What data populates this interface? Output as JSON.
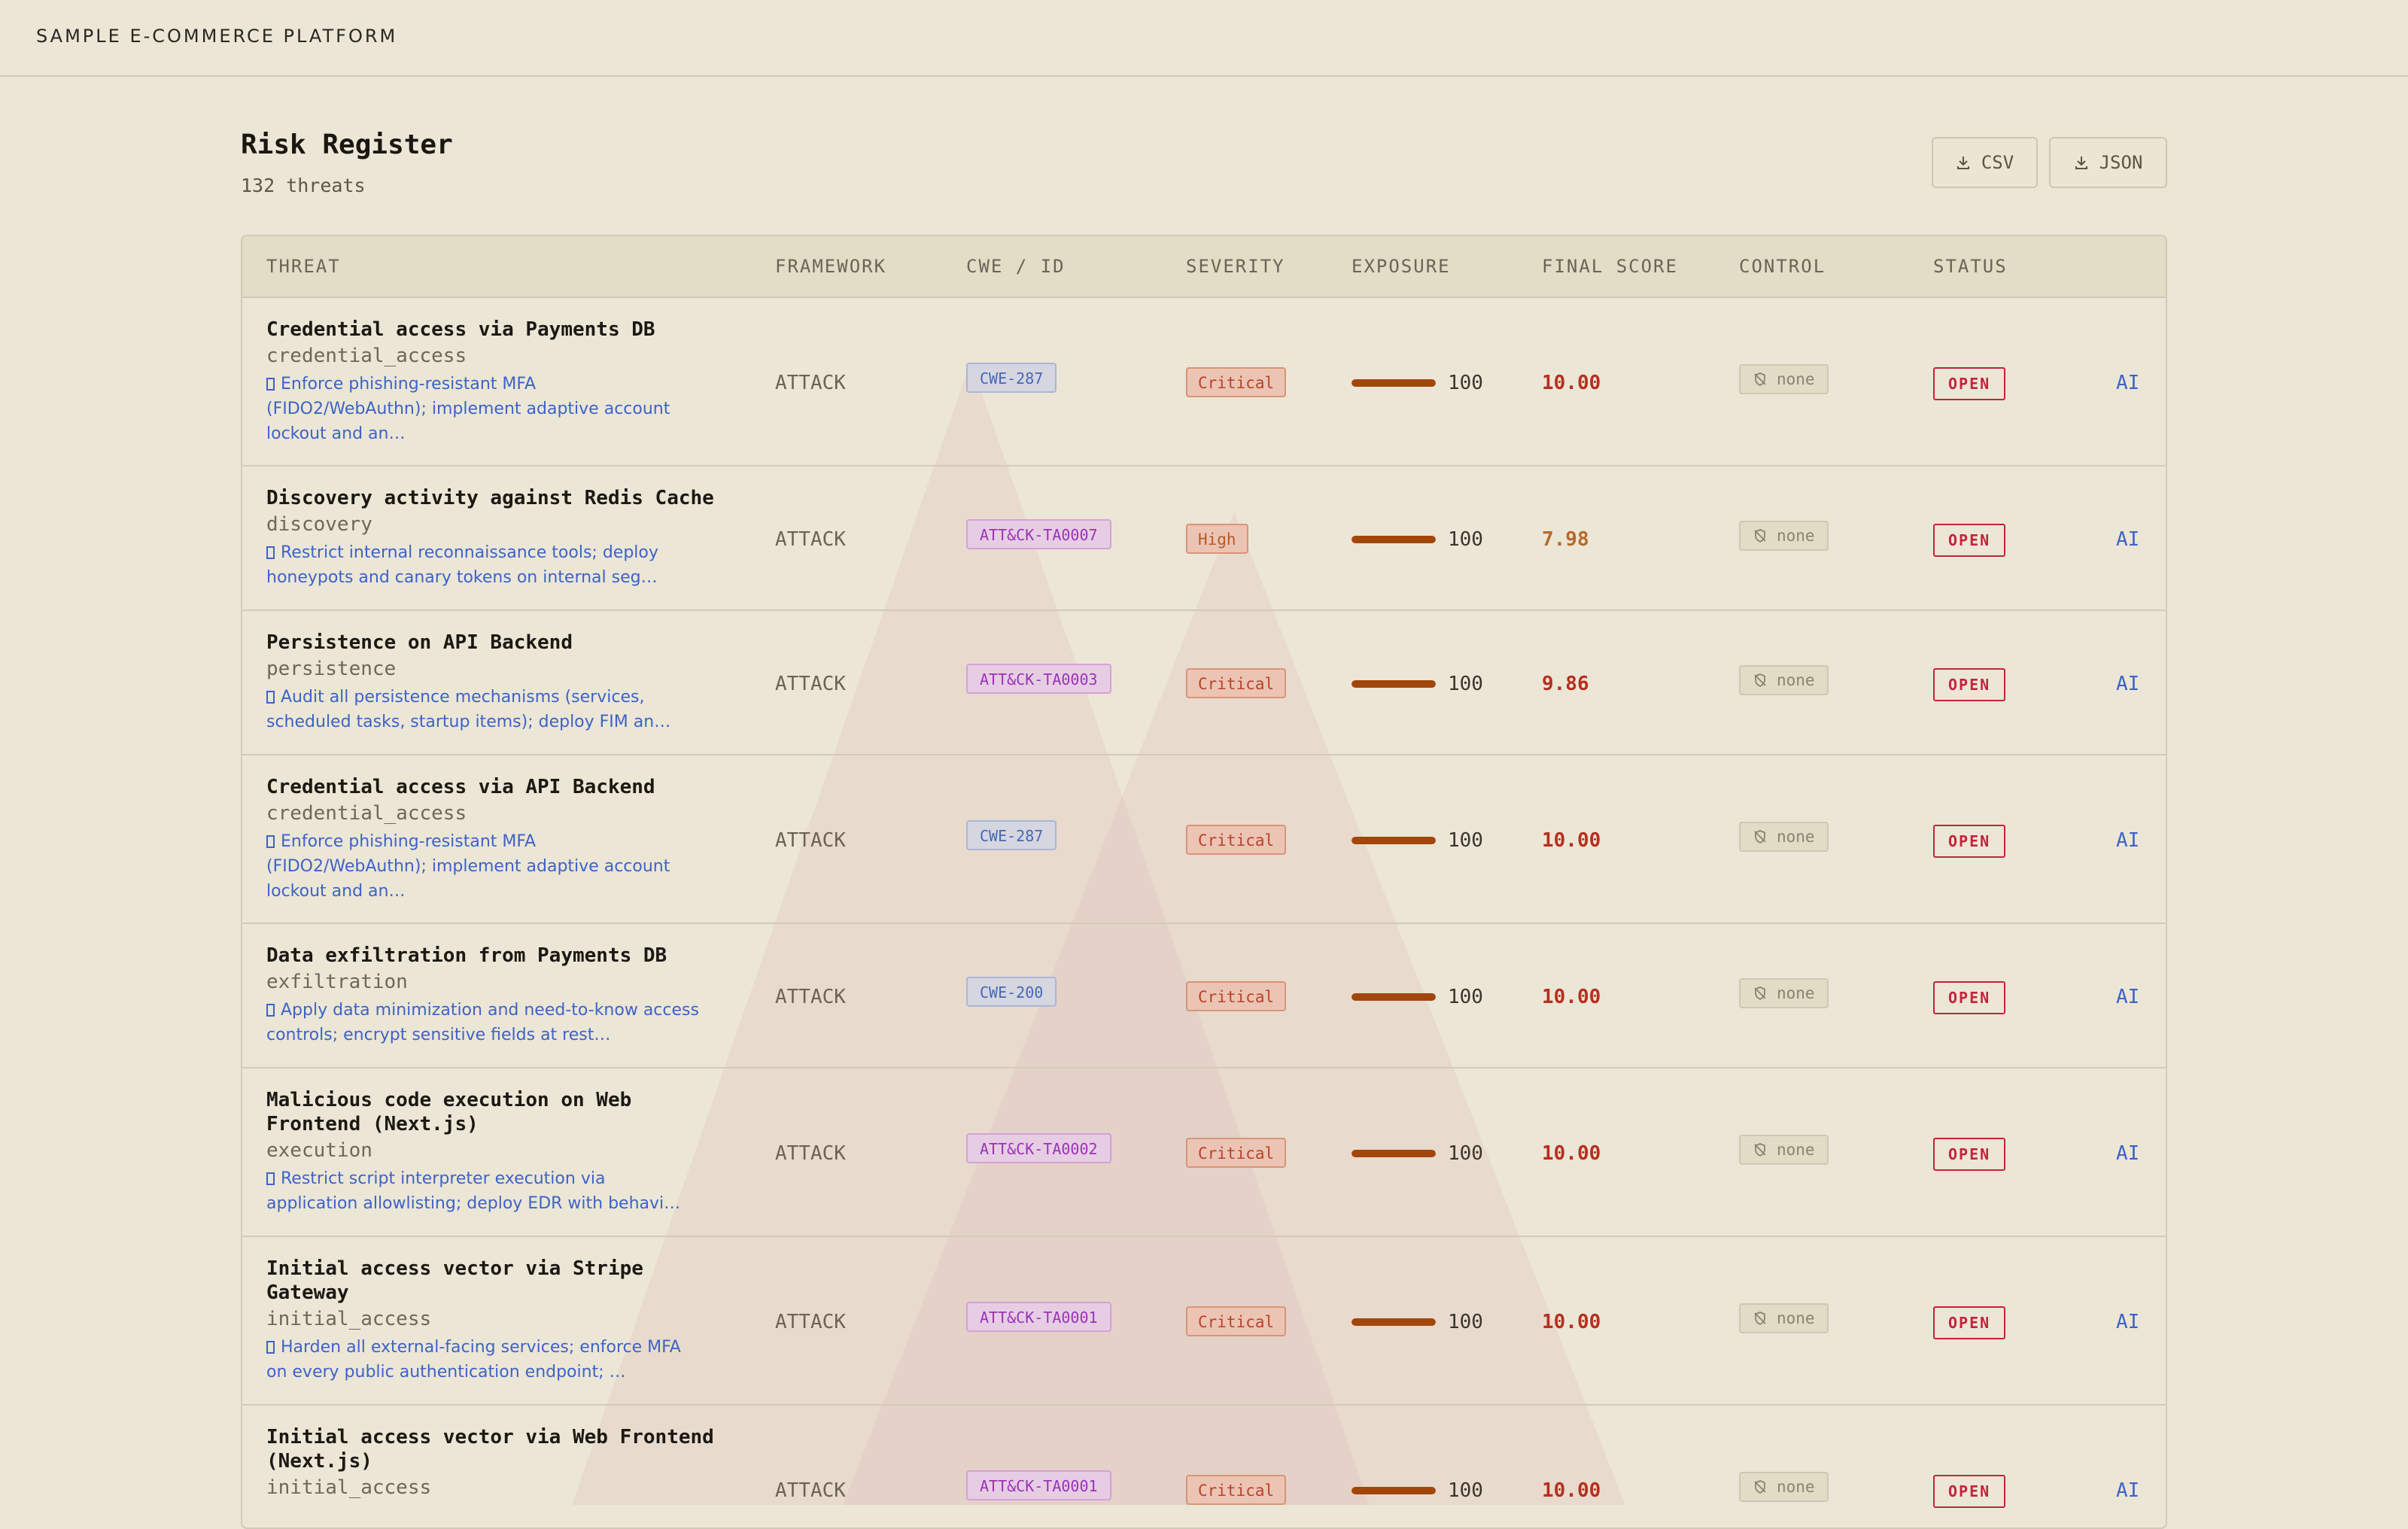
{
  "app": {
    "brand": "SAMPLE E-COMMERCE PLATFORM"
  },
  "page": {
    "title": "Risk Register",
    "count": "132 threats"
  },
  "exports": [
    {
      "label": "CSV",
      "icon": "download-icon"
    },
    {
      "label": "JSON",
      "icon": "download-icon"
    }
  ],
  "columns": {
    "threat": "THREAT",
    "framework": "FRAMEWORK",
    "cwe": "CWE / ID",
    "severity": "SEVERITY",
    "exposure": "EXPOSURE",
    "final_score": "FINAL SCORE",
    "control": "CONTROL",
    "status": "STATUS"
  },
  "colors": {
    "background": "#ece6d6",
    "critical": "#b5301f",
    "high": "#b56a2c",
    "status_open": "#c4233b",
    "link": "#3d63c8",
    "exposure_fill": "#a2470c"
  },
  "rows": [
    {
      "title_lines": [
        "Credential access via Payments DB"
      ],
      "category": "credential_access",
      "mitigation_lines": [
        "Enforce phishing-resistant MFA",
        "(FIDO2/WebAuthn); implement adaptive account",
        "lockout and an…"
      ],
      "framework": "ATTACK",
      "cwe": "CWE-287",
      "cwe_kind": "cwe",
      "severity": "Critical",
      "exposure": 100,
      "exposure_label": "100",
      "score": "10.00",
      "control": "none",
      "control_icon": "shield-off-icon",
      "status": "OPEN",
      "action": "AI"
    },
    {
      "title_lines": [
        "Discovery activity against Redis Cache"
      ],
      "category": "discovery",
      "mitigation_lines": [
        "Restrict internal reconnaissance tools; deploy",
        "honeypots and canary tokens on internal seg…"
      ],
      "framework": "ATTACK",
      "cwe": "ATT&CK-TA0007",
      "cwe_kind": "attack",
      "severity": "High",
      "exposure": 100,
      "exposure_label": "100",
      "score": "7.98",
      "control": "none",
      "control_icon": "shield-off-icon",
      "status": "OPEN",
      "action": "AI"
    },
    {
      "title_lines": [
        "Persistence on API Backend"
      ],
      "category": "persistence",
      "mitigation_lines": [
        "Audit all persistence mechanisms (services,",
        "scheduled tasks, startup items); deploy FIM an…"
      ],
      "framework": "ATTACK",
      "cwe": "ATT&CK-TA0003",
      "cwe_kind": "attack",
      "severity": "Critical",
      "exposure": 100,
      "exposure_label": "100",
      "score": "9.86",
      "control": "none",
      "control_icon": "shield-off-icon",
      "status": "OPEN",
      "action": "AI"
    },
    {
      "title_lines": [
        "Credential access via API Backend"
      ],
      "category": "credential_access",
      "mitigation_lines": [
        "Enforce phishing-resistant MFA",
        "(FIDO2/WebAuthn); implement adaptive account",
        "lockout and an…"
      ],
      "framework": "ATTACK",
      "cwe": "CWE-287",
      "cwe_kind": "cwe",
      "severity": "Critical",
      "exposure": 100,
      "exposure_label": "100",
      "score": "10.00",
      "control": "none",
      "control_icon": "shield-off-icon",
      "status": "OPEN",
      "action": "AI"
    },
    {
      "title_lines": [
        "Data exfiltration from Payments DB"
      ],
      "category": "exfiltration",
      "mitigation_lines": [
        "Apply data minimization and need-to-know access",
        "controls; encrypt sensitive fields at rest…"
      ],
      "framework": "ATTACK",
      "cwe": "CWE-200",
      "cwe_kind": "cwe",
      "severity": "Critical",
      "exposure": 100,
      "exposure_label": "100",
      "score": "10.00",
      "control": "none",
      "control_icon": "shield-off-icon",
      "status": "OPEN",
      "action": "AI"
    },
    {
      "title_lines": [
        "Malicious code execution on Web",
        "Frontend (Next.js)"
      ],
      "category": "execution",
      "mitigation_lines": [
        "Restrict script interpreter execution via",
        "application allowlisting; deploy EDR with behavi…"
      ],
      "framework": "ATTACK",
      "cwe": "ATT&CK-TA0002",
      "cwe_kind": "attack",
      "severity": "Critical",
      "exposure": 100,
      "exposure_label": "100",
      "score": "10.00",
      "control": "none",
      "control_icon": "shield-off-icon",
      "status": "OPEN",
      "action": "AI"
    },
    {
      "title_lines": [
        "Initial access vector via Stripe",
        "Gateway"
      ],
      "category": "initial_access",
      "mitigation_lines": [
        "Harden all external-facing services; enforce MFA",
        "on every public authentication endpoint; …"
      ],
      "framework": "ATTACK",
      "cwe": "ATT&CK-TA0001",
      "cwe_kind": "attack",
      "severity": "Critical",
      "exposure": 100,
      "exposure_label": "100",
      "score": "10.00",
      "control": "none",
      "control_icon": "shield-off-icon",
      "status": "OPEN",
      "action": "AI"
    },
    {
      "title_lines": [
        "Initial access vector via Web Frontend",
        "(Next.js)"
      ],
      "category": "initial_access",
      "mitigation_lines": [],
      "framework": "ATTACK",
      "cwe": "ATT&CK-TA0001",
      "cwe_kind": "attack",
      "severity": "Critical",
      "exposure": 100,
      "exposure_label": "100",
      "score": "10.00",
      "control": "none",
      "control_icon": "shield-off-icon",
      "status": "OPEN",
      "action": "AI"
    }
  ]
}
